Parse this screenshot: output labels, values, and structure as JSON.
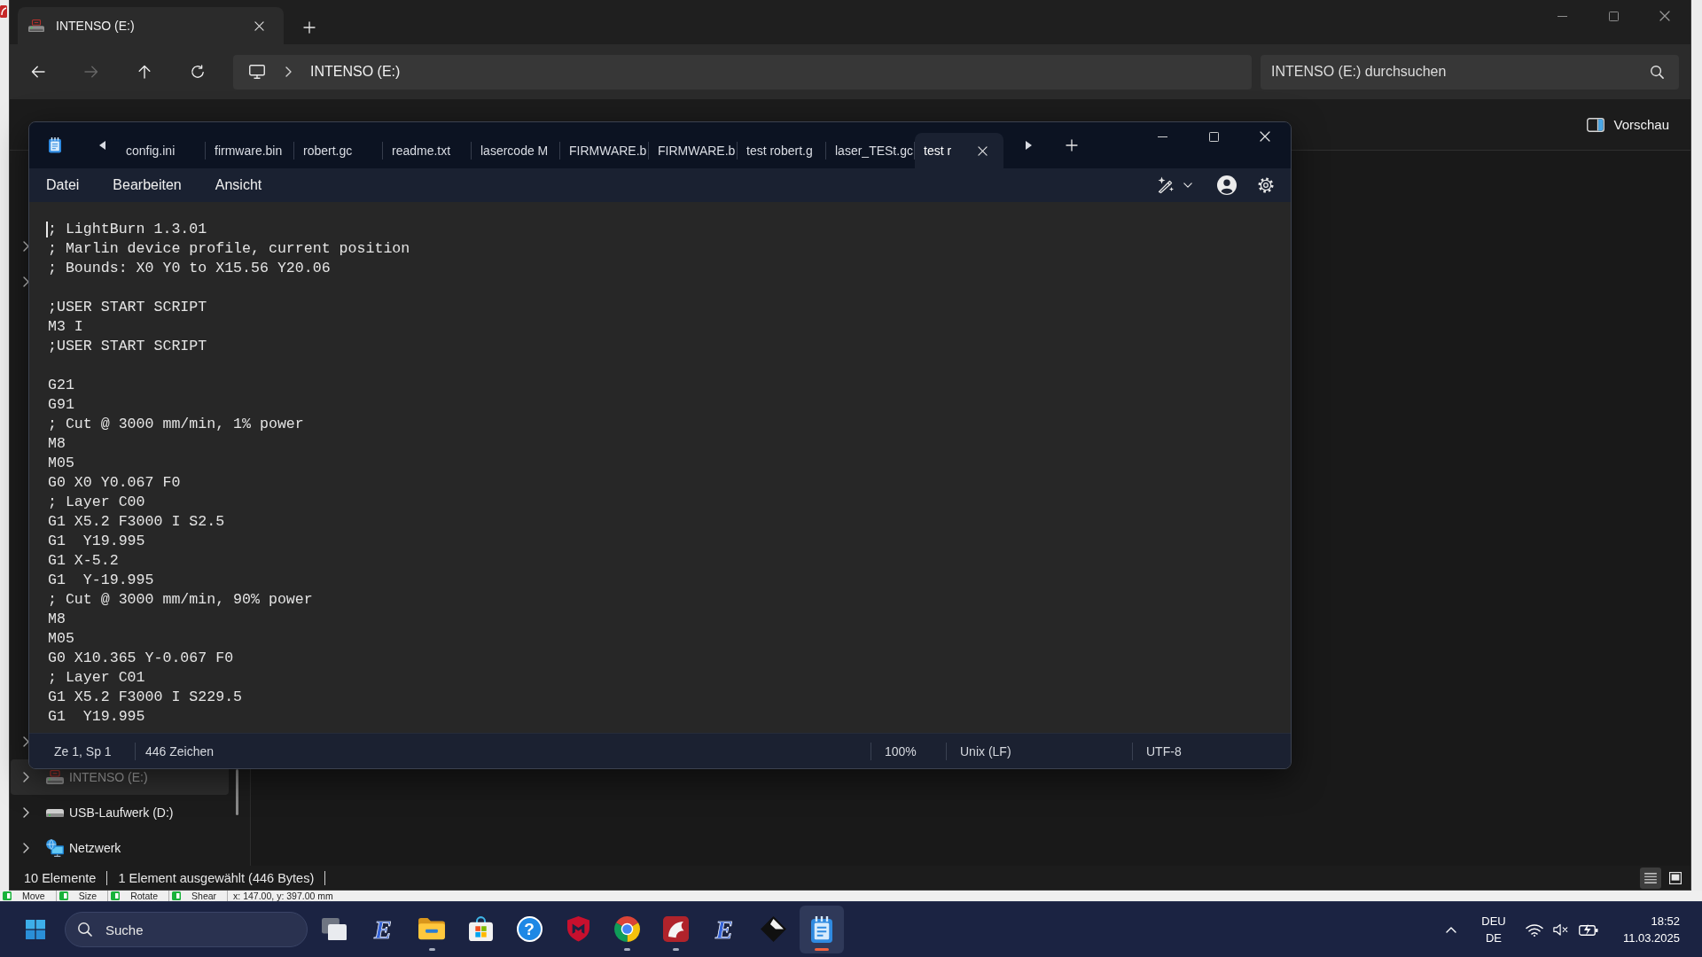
{
  "background_window": {
    "tools": [
      {
        "label": "Move"
      },
      {
        "label": "Size"
      },
      {
        "label": "Rotate"
      },
      {
        "label": "Shear"
      }
    ],
    "coordinates": "x: 147.00, y: 397.00 mm"
  },
  "explorer": {
    "tabs": [
      {
        "label": "INTENSO (E:)",
        "selected": true
      }
    ],
    "nav_buttons": [
      {
        "kind": "back",
        "disabled": false
      },
      {
        "kind": "forward",
        "disabled": true
      },
      {
        "kind": "up",
        "disabled": false
      },
      {
        "kind": "refresh",
        "disabled": false
      }
    ],
    "address": {
      "path": [
        "INTENSO (E:)"
      ]
    },
    "search": {
      "placeholder": "INTENSO (E:) durchsuchen"
    },
    "preview_button": {
      "label": "Vorschau"
    },
    "nav_tree": {
      "upper": [
        {
          "expanded": false
        },
        {
          "expanded": false
        }
      ],
      "lower": [
        {
          "expanded": false
        },
        {
          "label": "INTENSO (E:)",
          "kind": "sdcard",
          "expanded": false,
          "selected": true
        },
        {
          "label": "USB-Laufwerk (D:)",
          "kind": "drive",
          "expanded": false,
          "selected": false
        },
        {
          "label": "Netzwerk",
          "kind": "network",
          "expanded": false,
          "selected": false
        }
      ]
    },
    "status_bar": {
      "item_count": "10 Elemente",
      "selection": "1 Element ausgewählt (446 Bytes)"
    },
    "view_buttons": [
      {
        "kind": "details",
        "selected": true
      },
      {
        "kind": "preview",
        "selected": false
      }
    ]
  },
  "notepad": {
    "tabs": [
      {
        "label": "config.ini",
        "selected": false
      },
      {
        "label": "firmware.bin",
        "selected": false
      },
      {
        "label": "robert.gc",
        "selected": false
      },
      {
        "label": "readme.txt",
        "selected": false
      },
      {
        "label": "lasercode M",
        "selected": false
      },
      {
        "label": "FIRMWARE.b",
        "selected": false
      },
      {
        "label": "FIRMWARE.b",
        "selected": false
      },
      {
        "label": "test robert.g",
        "selected": false
      },
      {
        "label": "laser_TESt.gc",
        "selected": false
      },
      {
        "label": "test r",
        "selected": true
      }
    ],
    "menu": [
      {
        "label": "Datei"
      },
      {
        "label": "Bearbeiten"
      },
      {
        "label": "Ansicht"
      }
    ],
    "editor": {
      "text": "; LightBurn 1.3.01\n; Marlin device profile, current position\n; Bounds: X0 Y0 to X15.56 Y20.06\n\n;USER START SCRIPT\nM3 I\n;USER START SCRIPT\n\nG21\nG91\n; Cut @ 3000 mm/min, 1% power\nM8\nM05\nG0 X0 Y0.067 F0\n; Layer C00\nG1 X5.2 F3000 I S2.5\nG1  Y19.995\nG1 X-5.2\nG1  Y-19.995\n; Cut @ 3000 mm/min, 90% power\nM8\nM05\nG0 X10.365 Y-0.067 F0\n; Layer C01\nG1 X5.2 F3000 I S229.5\nG1  Y19.995"
    },
    "status_bar": {
      "position": "Ze 1, Sp 1",
      "characters": "446 Zeichen",
      "zoom": "100%",
      "line_ending": "Unix (LF)",
      "encoding": "UTF-8"
    }
  },
  "taskbar": {
    "search": {
      "placeholder": "Suche"
    },
    "apps": [
      {
        "kind": "taskview",
        "running": false,
        "active": false
      },
      {
        "kind": "letter",
        "symbol": "E",
        "running": false,
        "active": false
      },
      {
        "kind": "folder",
        "running": true,
        "active": false
      },
      {
        "kind": "store",
        "running": false,
        "active": false
      },
      {
        "kind": "help",
        "symbol": "?",
        "running": false,
        "active": false
      },
      {
        "kind": "shield",
        "running": false,
        "active": false
      },
      {
        "kind": "tricolor",
        "running": true,
        "active": false
      },
      {
        "kind": "redtile",
        "running": true,
        "active": false
      },
      {
        "kind": "letter",
        "symbol": "E",
        "running": false,
        "active": false
      },
      {
        "kind": "diamond",
        "running": false,
        "active": false
      },
      {
        "kind": "notepad",
        "running": true,
        "active": true
      }
    ],
    "tray": {
      "language": "DEU",
      "layout": "DE",
      "time": "18:52",
      "date": "11.03.2025"
    }
  }
}
